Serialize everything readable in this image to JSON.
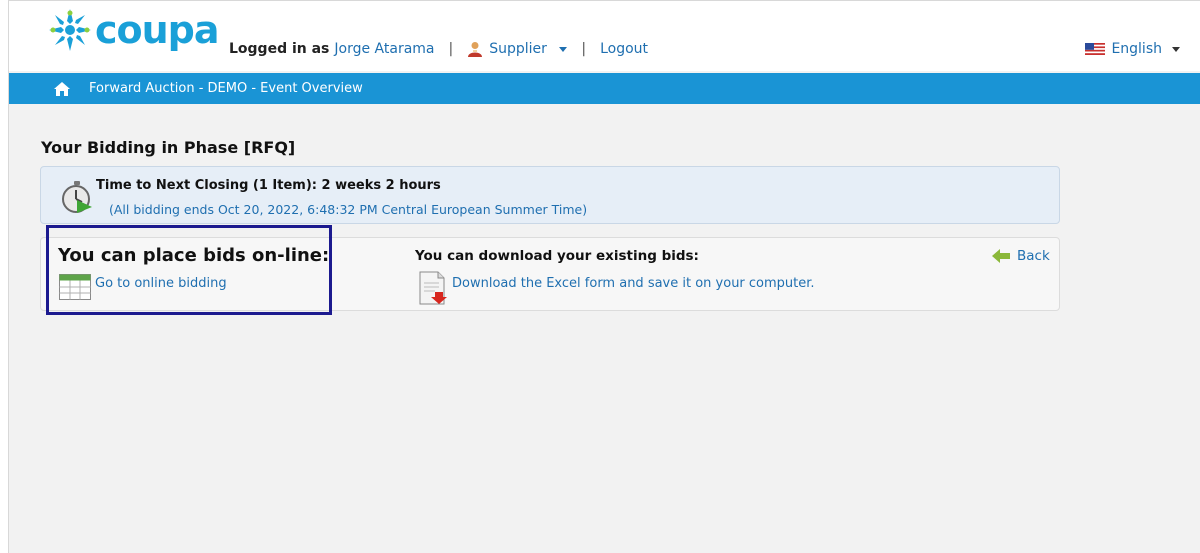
{
  "header": {
    "logo_text": "coupa",
    "logged_in_label": "Logged in as",
    "user_name": "Jorge Atarama",
    "separator": "|",
    "role": "Supplier",
    "logout": "Logout",
    "language": "English"
  },
  "nav": {
    "breadcrumb": "Forward Auction - DEMO - Event Overview"
  },
  "main": {
    "title": "Your Bidding in Phase [RFQ]",
    "timer": {
      "headline": "Time to Next Closing (1 Item):  2 weeks 2 hours",
      "detail": "(All bidding ends Oct 20, 2022, 6:48:32 PM Central European Summer Time)"
    },
    "online": {
      "title": "You can place bids on-line:",
      "link": "Go to online bidding"
    },
    "download": {
      "title": "You can download your existing bids:",
      "link": "Download the Excel form and save it on your computer."
    },
    "back": "Back"
  },
  "colors": {
    "brand_blue": "#1a94d5",
    "link_blue": "#1f6fb0",
    "highlight": "#1c1a8f"
  },
  "icons": [
    "coupa-logo-icon",
    "person-icon",
    "us-flag-icon",
    "home-icon",
    "stopwatch-icon",
    "spreadsheet-icon",
    "excel-download-icon",
    "back-arrow-icon"
  ]
}
